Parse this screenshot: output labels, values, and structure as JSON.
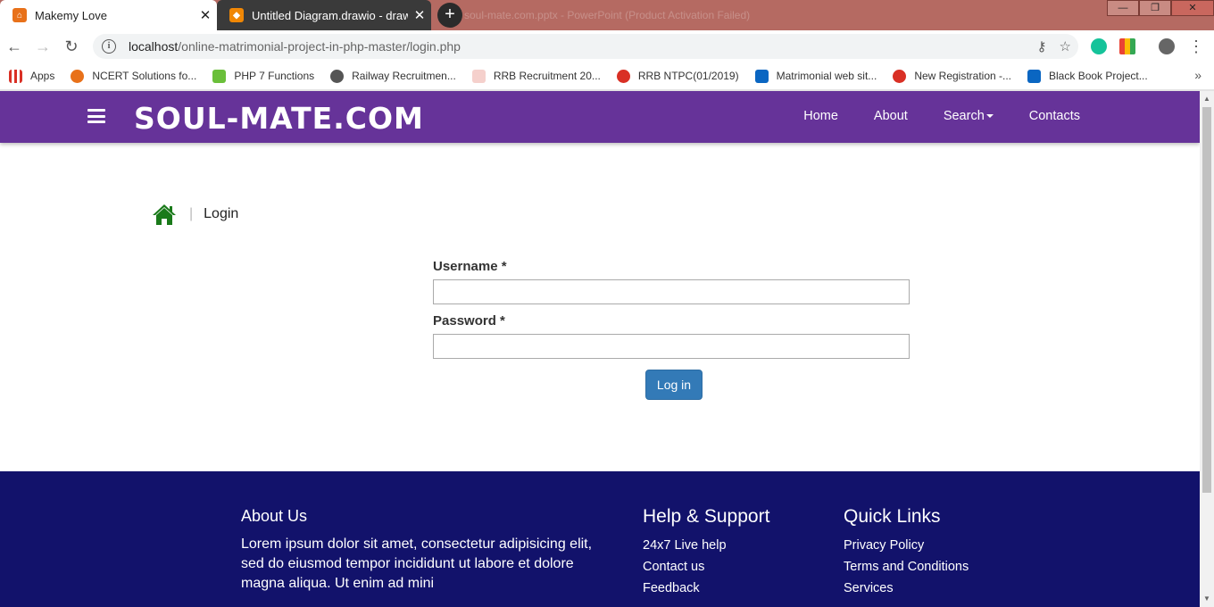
{
  "browser": {
    "tabs": [
      {
        "title": "Makemy Love",
        "active": true
      },
      {
        "title": "Untitled Diagram.drawio - draw.io",
        "active": false
      }
    ],
    "background_window_title": "soul-mate.com.pptx - PowerPoint (Product Activation Failed)",
    "url_host": "localhost",
    "url_path": "/online-matrimonial-project-in-php-master/login.php",
    "bookmarks": [
      {
        "label": "Apps",
        "icon_color": "#d93025"
      },
      {
        "label": "NCERT Solutions fo...",
        "icon_color": "#e8711a"
      },
      {
        "label": "PHP 7 Functions",
        "icon_color": "#6abf3a"
      },
      {
        "label": "Railway Recruitmen...",
        "icon_color": "#555555"
      },
      {
        "label": "RRB Recruitment 20...",
        "icon_color": "#c0392b"
      },
      {
        "label": "RRB NTPC(01/2019)",
        "icon_color": "#d93025"
      },
      {
        "label": "Matrimonial web sit...",
        "icon_color": "#0a66c2"
      },
      {
        "label": "New Registration -...",
        "icon_color": "#d93025"
      },
      {
        "label": "Black Book Project...",
        "icon_color": "#0a66c2"
      }
    ]
  },
  "site": {
    "brand": "SOUL-MATE.COM",
    "nav": {
      "home": "Home",
      "about": "About",
      "search": "Search",
      "contacts": "Contacts"
    },
    "colors": {
      "nav_bg": "#663399",
      "footer_bg": "#12126b",
      "button": "#337ab7",
      "home_icon": "#1a7a1a"
    }
  },
  "breadcrumb": {
    "current": "Login"
  },
  "form": {
    "username_label": "Username *",
    "password_label": "Password *",
    "username_value": "",
    "password_value": "",
    "submit_label": "Log in"
  },
  "footer": {
    "about": {
      "title": "About Us",
      "text": "Lorem ipsum dolor sit amet, consectetur adipisicing elit, sed do eiusmod tempor incididunt ut labore et dolore magna aliqua. Ut enim ad mini"
    },
    "help": {
      "title": "Help & Support",
      "links": [
        "24x7 Live help",
        "Contact us",
        "Feedback"
      ]
    },
    "quick": {
      "title": "Quick Links",
      "links": [
        "Privacy Policy",
        "Terms and Conditions",
        "Services"
      ]
    }
  }
}
